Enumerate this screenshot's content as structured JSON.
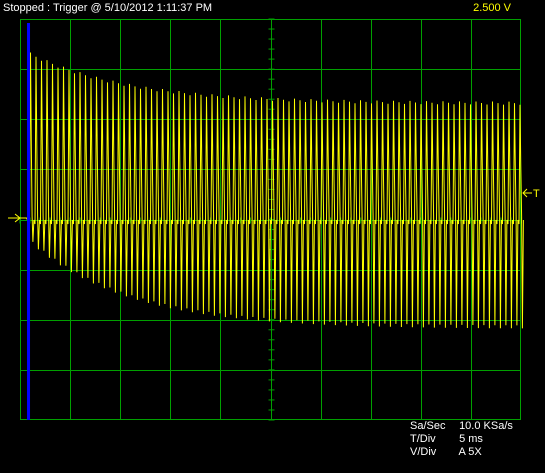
{
  "status": {
    "text": "Stopped : Trigger @ 5/10/2012 1:11:37 PM",
    "volts_per_div": "2.500  V"
  },
  "markers": {
    "trigger_label": "T"
  },
  "readout": {
    "sample_rate_label": "Sa/Sec",
    "sample_rate_value": "10.0 KSa/s",
    "time_div_label": "T/Div",
    "time_div_value": "5 ms",
    "volt_div_label": "V/Div",
    "volt_div_value": "A 5X"
  },
  "colors": {
    "background": "#000000",
    "grid": "#00a000",
    "trace": "#ffff00",
    "cursor": "#0000ff"
  },
  "chart_data": {
    "type": "line",
    "grid": true,
    "grid_divisions": {
      "x": 10,
      "y": 8
    },
    "trigger_cursor_division": 0.17,
    "trace_description": "yellow oscillating waveform with decaying peaks"
  }
}
